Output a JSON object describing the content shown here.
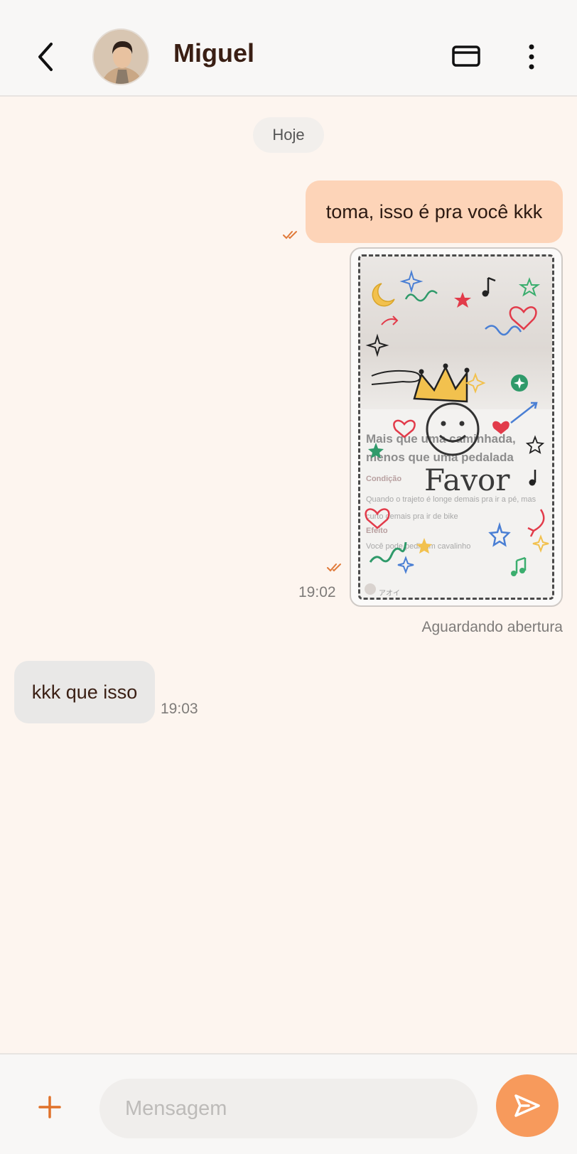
{
  "header": {
    "contact_name": "Miguel",
    "icons": [
      "chevron-left-icon",
      "card-icon",
      "more-vertical-icon"
    ]
  },
  "conversation": {
    "date_separator": "Hoje",
    "messages": [
      {
        "direction": "outgoing",
        "type": "text",
        "text": "toma, isso é pra você kkk",
        "read": true
      },
      {
        "direction": "outgoing",
        "type": "favor-card",
        "time": "19:02",
        "read": true,
        "status": "Aguardando abertura",
        "card": {
          "title": "Favor",
          "heading": "Mais que uma caminhada, menos que uma pedalada",
          "condition_label": "Condição",
          "condition_text": "Quando o trajeto é longe demais pra ir a pé, mas curto demais pra ir de bike",
          "effect_label": "Efeito",
          "effect_text": "Você pode pedir um cavalinho",
          "author": "アオイ"
        }
      },
      {
        "direction": "incoming",
        "type": "text",
        "text": "kkk que isso",
        "time": "19:03"
      }
    ]
  },
  "composer": {
    "placeholder": "Mensagem",
    "icons": [
      "plus-icon",
      "send-icon"
    ]
  },
  "colors": {
    "accent": "#f79a5c",
    "outgoing_bubble": "#fdd4b8",
    "incoming_bubble": "#e9e8e7",
    "background": "#fdf5ef",
    "read_check": "#e07a3a"
  }
}
